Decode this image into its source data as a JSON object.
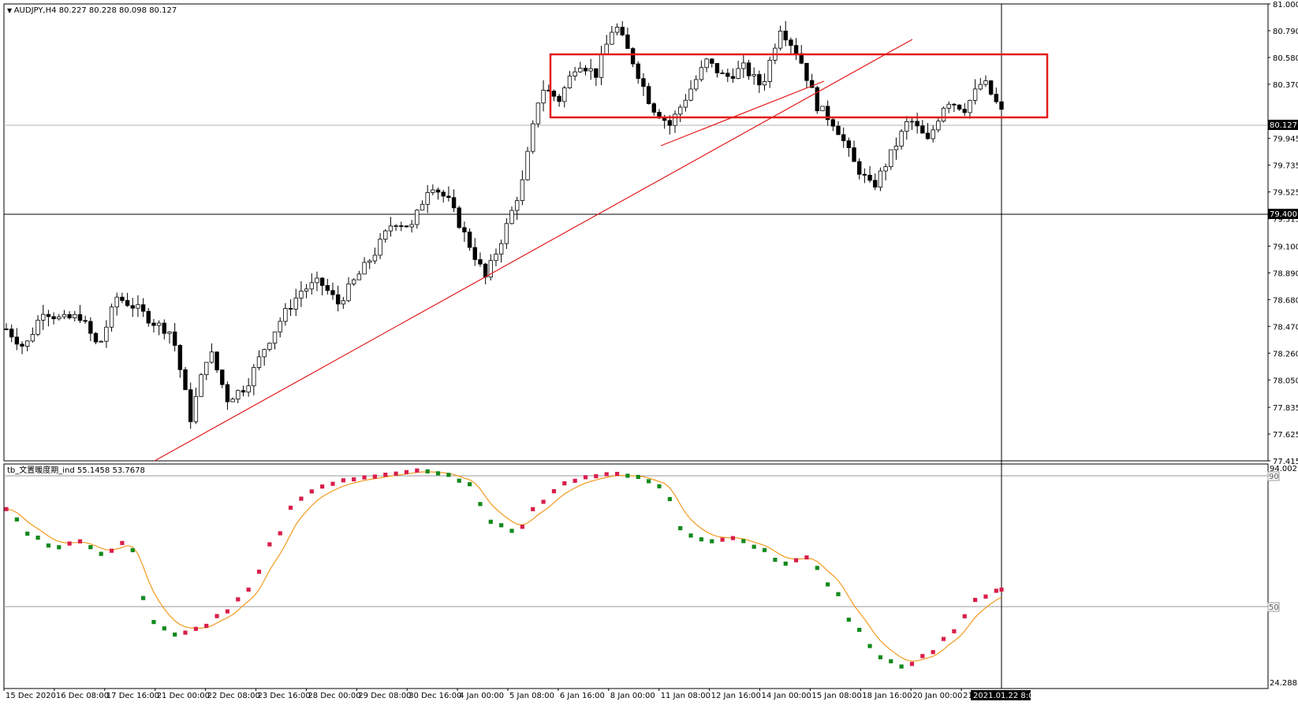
{
  "window": {
    "symbol_title": "AUDJPY,H4",
    "ohlc": "80.227 80.228 80.098 80.127",
    "indicator_title": "tb_文置暖度期_ind",
    "indicator_values": "55.1458 53.7678"
  },
  "colors": {
    "background": "#ffffff",
    "candle_up_fill": "#ffffff",
    "candle_down_fill": "#000000",
    "candle_outline": "#000000",
    "annotation": "#e31b1b",
    "dot_up": "#d81e4a",
    "dot_down": "#138a1d",
    "signal_line": "#f39a1e",
    "gridline": "#9a9a9a",
    "crosshair": "#000000"
  },
  "chart_data": [
    {
      "type": "candlestick",
      "symbol": "AUDJPY",
      "timeframe": "H4",
      "y_ticks": [
        "81.000",
        "80.790",
        "80.580",
        "80.370",
        "79.945",
        "79.735",
        "79.525",
        "79.315",
        "79.100",
        "78.890",
        "78.680",
        "78.470",
        "78.260",
        "78.050",
        "77.835",
        "77.625",
        "77.415"
      ],
      "ylim": [
        77.415,
        81.0
      ],
      "price_markers": {
        "current": "80.127",
        "crosshair": "79.400"
      },
      "x_ticks": [
        "15 Dec 2020",
        "16 Dec 08:00",
        "17 Dec 16:00",
        "21 Dec 00:00",
        "22 Dec 08:00",
        "23 Dec 16:00",
        "28 Dec 00:00",
        "29 Dec 08:00",
        "30 Dec 16:00",
        "4 Jan 00:00",
        "5 Jan 08:00",
        "6 Jan 16:00",
        "8 Jan 00:00",
        "11 Jan 08:00",
        "12 Jan 16:00",
        "14 Jan 00:00",
        "15 Jan 08:00",
        "18 Jan 16:00",
        "20 Jan 00:00",
        "21"
      ],
      "crosshair_time_label": "2021.01.22 8:00",
      "price_path": [
        78.45,
        78.3,
        78.6,
        78.52,
        78.55,
        78.3,
        78.7,
        78.62,
        78.5,
        78.42,
        77.75,
        78.3,
        77.9,
        78.0,
        78.3,
        78.55,
        78.75,
        78.82,
        78.65,
        78.85,
        79.05,
        79.3,
        79.25,
        79.6,
        79.45,
        79.15,
        78.85,
        79.2,
        79.6,
        80.35,
        80.25,
        80.55,
        80.45,
        80.85,
        80.55,
        80.2,
        80.05,
        80.3,
        80.55,
        80.42,
        80.5,
        80.35,
        80.82,
        80.6,
        80.2,
        80.05,
        79.75,
        79.55,
        79.82,
        80.1,
        79.92,
        80.25,
        80.18,
        80.4,
        80.15
      ],
      "series": [
        {
          "name": "",
          "type": "channel",
          "points": [
            [
              "8 Jan 00:00",
              80.7
            ],
            [
              "8 Jan 00:00",
              80.22
            ],
            [
              "20 Jan 00:00",
              80.22
            ],
            [
              "20 Jan 00:00",
              80.7
            ]
          ]
        }
      ],
      "annotations": [
        {
          "type": "rectangle",
          "price_top": 80.7,
          "price_bottom": 80.22
        },
        {
          "type": "trendline",
          "from_price": 77.415,
          "to_price": 80.9
        },
        {
          "type": "trendline",
          "from_price": 80.0,
          "to_price": 80.48
        }
      ]
    },
    {
      "type": "scatter",
      "name": "tb_文置暖度期_ind",
      "y_ticks": [
        "94.0021",
        "90",
        "50",
        "24.2881"
      ],
      "ylim": [
        24.2881,
        94.0021
      ],
      "reference_lines": [
        90,
        50
      ],
      "dot_path": [
        80,
        72,
        68,
        70,
        66,
        70,
        45,
        41,
        43,
        48,
        55,
        70,
        83,
        87,
        89,
        90,
        91,
        92,
        91,
        88,
        76,
        73,
        82,
        88,
        90,
        91,
        90,
        87,
        72,
        70,
        71,
        68,
        63,
        65,
        56,
        43,
        34,
        31,
        35,
        42,
        52,
        55
      ]
    }
  ]
}
